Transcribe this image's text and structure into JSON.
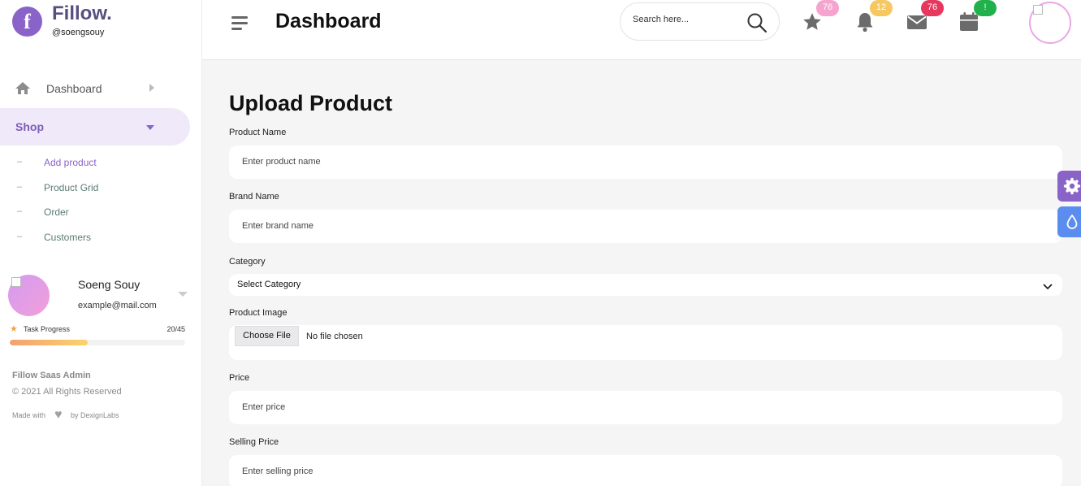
{
  "brand": {
    "logo_letter": "f",
    "name": "Fillow.",
    "handle": "@soengsouy",
    "color": "#8a63c9"
  },
  "sidebar": {
    "dashboard_label": "Dashboard",
    "shop_label": "Shop",
    "shop_items": [
      {
        "label": "Add product",
        "active": true
      },
      {
        "label": "Product Grid"
      },
      {
        "label": "Order"
      },
      {
        "label": "Customers"
      }
    ],
    "user": {
      "name": "Soeng Souy",
      "email": "example@mail.com"
    },
    "task": {
      "label": "Task Progress",
      "count": "20/45",
      "progress": 0.444
    },
    "footer": {
      "title": "Fillow Saas Admin",
      "copyright": "© 2021 All Rights Reserved",
      "made_with": "Made with",
      "by": "by DexignLabs"
    }
  },
  "header": {
    "title": "Dashboard",
    "search_placeholder": "Search here...",
    "badges": {
      "favorites": "76",
      "notifications": "12",
      "messages": "76",
      "calendar": "!"
    }
  },
  "form": {
    "title": "Upload Product",
    "product_name": {
      "label": "Product Name",
      "placeholder": "Enter product name"
    },
    "brand_name": {
      "label": "Brand Name",
      "placeholder": "Enter brand name"
    },
    "category": {
      "label": "Category",
      "value": "Select Category"
    },
    "product_image": {
      "label": "Product Image",
      "button": "Choose File",
      "status": "No file chosen"
    },
    "price": {
      "label": "Price",
      "placeholder": "Enter price"
    },
    "selling_price": {
      "label": "Selling Price",
      "placeholder": "Enter selling price"
    }
  }
}
